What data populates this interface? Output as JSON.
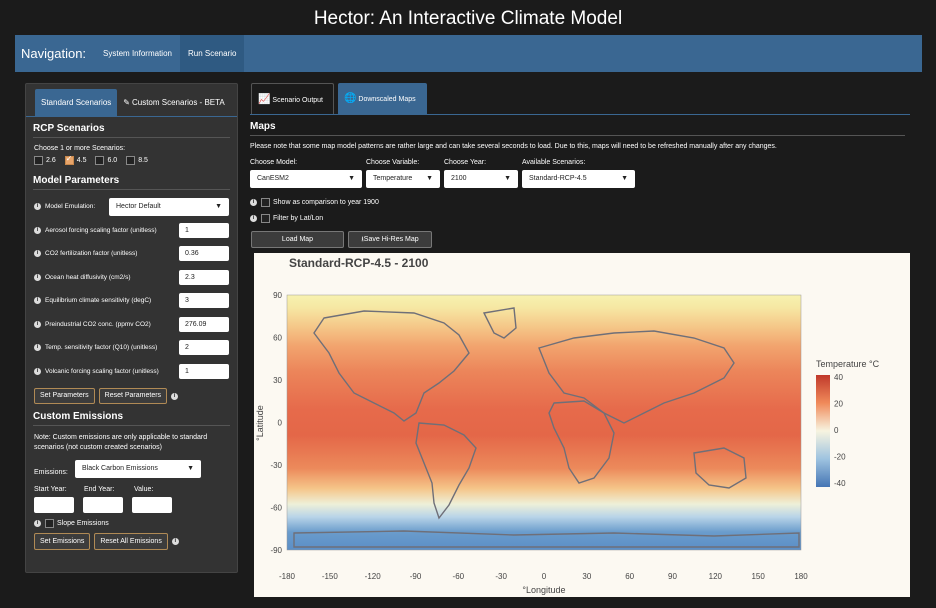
{
  "app": {
    "title": "Hector: An Interactive Climate Model"
  },
  "nav": {
    "brand": "Navigation:",
    "items": [
      "System Information",
      "Run Scenario"
    ]
  },
  "left": {
    "tabs": [
      "Standard Scenarios",
      "Custom Scenarios - BETA"
    ],
    "rcp": {
      "title": "RCP Scenarios",
      "prompt": "Choose 1 or more Scenarios:",
      "options": [
        {
          "label": "2.6",
          "checked": false
        },
        {
          "label": "4.5",
          "checked": true
        },
        {
          "label": "6.0",
          "checked": false
        },
        {
          "label": "8.5",
          "checked": false
        }
      ]
    },
    "params": {
      "title": "Model Parameters",
      "emulation_label": "Model Emulation:",
      "emulation_value": "Hector Default",
      "rows": [
        {
          "label": "Aerosol forcing scaling factor (unitless)",
          "value": "1"
        },
        {
          "label": "CO2 fertilization factor (unitless)",
          "value": "0.36"
        },
        {
          "label": "Ocean heat diffusivity (cm2/s)",
          "value": "2.3"
        },
        {
          "label": "Equilibrium climate sensitivity (degC)",
          "value": "3"
        },
        {
          "label": "Preindustrial CO2 conc. (ppmv CO2)",
          "value": "276.09"
        },
        {
          "label": "Temp. sensitivity factor (Q10) (unitless)",
          "value": "2"
        },
        {
          "label": "Volcanic forcing scaling factor (unitless)",
          "value": "1"
        }
      ],
      "set_btn": "Set Parameters",
      "reset_btn": "Reset Parameters"
    },
    "custom": {
      "title": "Custom Emissions",
      "note": "Note: Custom emissions are only applicable to standard scenarios (not custom created scenarios)",
      "emissions_label": "Emissions:",
      "emissions_value": "Black Carbon Emissions",
      "start_label": "Start Year:",
      "end_label": "End Year:",
      "value_label": "Value:",
      "slope_label": "Slope Emissions",
      "set_btn": "Set Emissions",
      "reset_btn": "Reset All Emissions"
    }
  },
  "right": {
    "tabs": [
      "Scenario Output",
      "Downscaled Maps"
    ],
    "maps_title": "Maps",
    "note": "Please note that some map model patterns are rather large and can take several seconds to load. Due to this, maps will need to be refreshed manually after any changes.",
    "model_label": "Choose Model:",
    "model_value": "CanESM2",
    "variable_label": "Choose Variable:",
    "variable_value": "Temperature",
    "year_label": "Choose Year:",
    "year_value": "2100",
    "scenario_label": "Available Scenarios:",
    "scenario_value": "Standard-RCP-4.5",
    "compare_label": "Show as comparison to year 1900",
    "filter_label": "Filter by Lat/Lon",
    "load_btn": "Load Map",
    "save_btn": "Save Hi-Res Map"
  },
  "map": {
    "title": "Standard-RCP-4.5 - 2100",
    "xlabel": "°Longitude",
    "ylabel": "°Latitude",
    "legend_title": "Temperature °C",
    "colorbar_ticks": [
      "40",
      "20",
      "0",
      "-20",
      "-40"
    ],
    "x_ticks": [
      "-180",
      "-150",
      "-120",
      "-90",
      "-60",
      "-30",
      "0",
      "30",
      "60",
      "90",
      "120",
      "150",
      "180"
    ],
    "y_ticks": [
      "90",
      "60",
      "30",
      "0",
      "-30",
      "-60",
      "-90"
    ],
    "colors": {
      "hot": "#d73027",
      "warm": "#f4a582",
      "neutral": "#f7f7b0",
      "cold": "#4575b4"
    }
  }
}
